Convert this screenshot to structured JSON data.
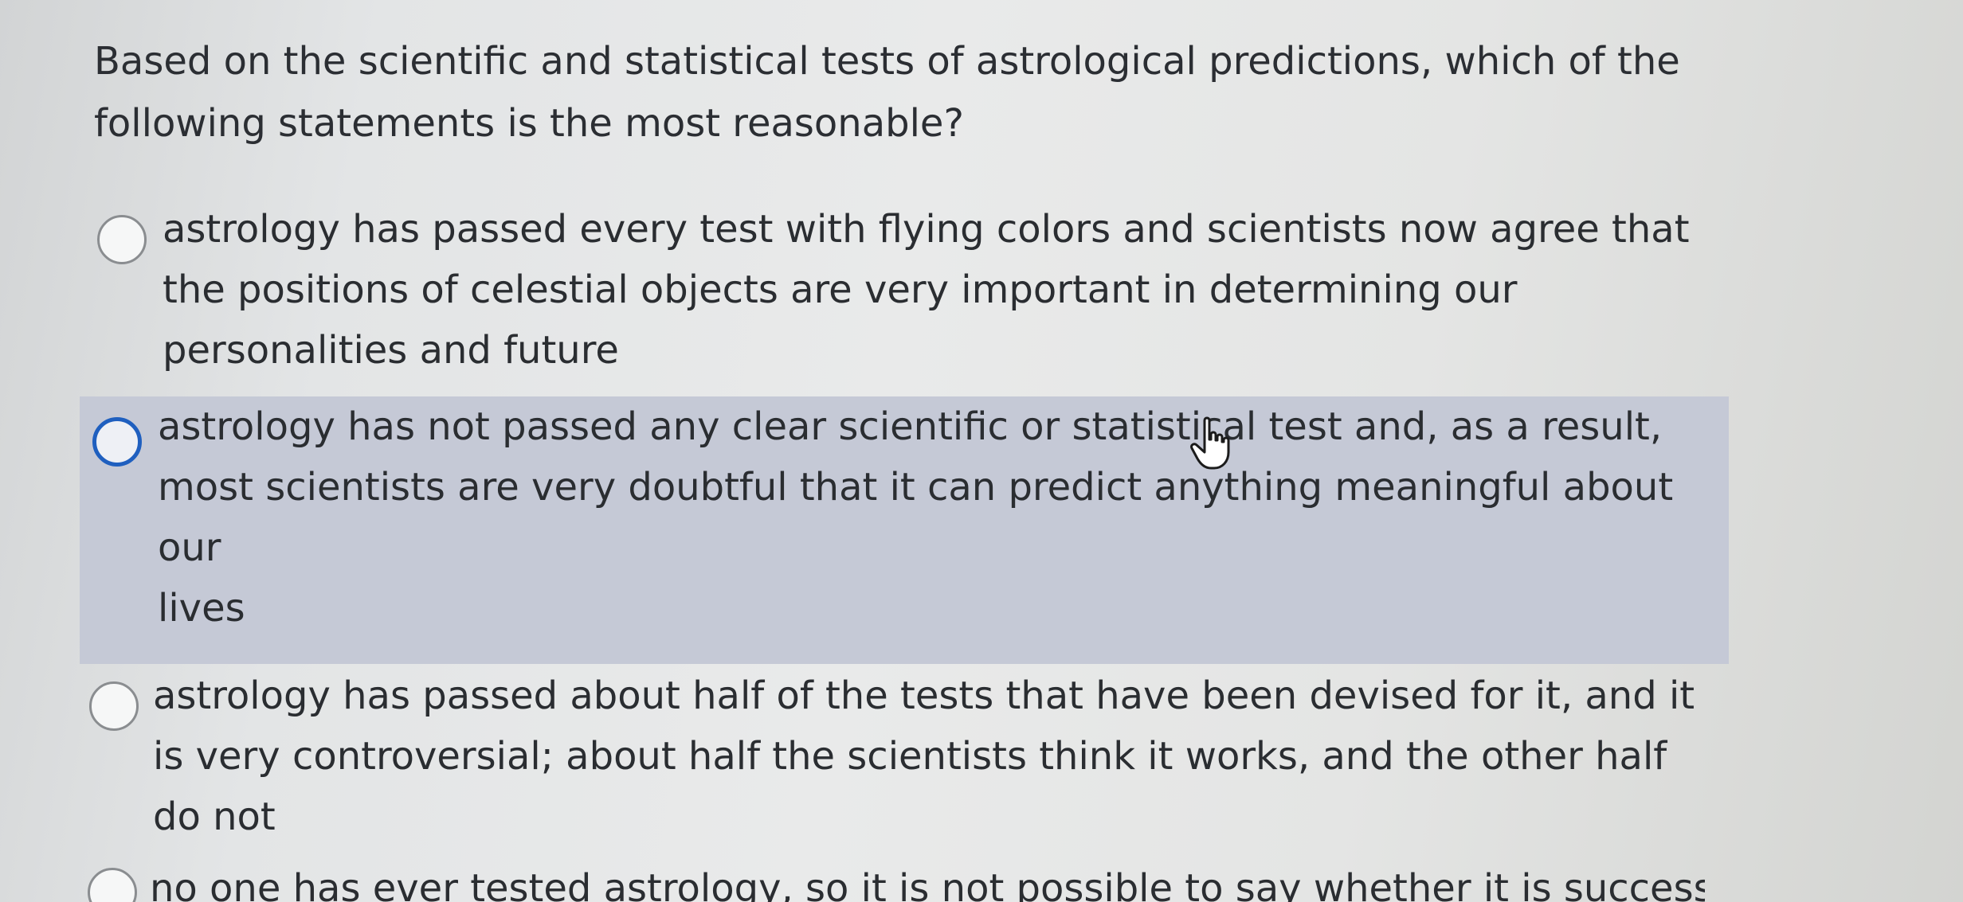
{
  "question": {
    "text": "Based on the scientific and statistical tests of astrological predictions, which of the following statements is the most reasonable?"
  },
  "options": [
    {
      "lines": [
        "astrology has passed every test with flying colors and scientists now agree that",
        "the positions of celestial objects are very important in determining our",
        "personalities and future"
      ],
      "selected": false
    },
    {
      "lines": [
        "astrology has not passed any clear scientific or statistical test and, as a result,",
        "most scientists are very doubtful that it can predict anything meaningful about",
        "our",
        "lives"
      ],
      "selected": false,
      "hovered": true
    },
    {
      "lines": [
        "astrology has passed about half of the tests that have been devised for it, and it",
        "is very controversial; about half the scientists think it works, and the other half",
        "do not"
      ],
      "selected": false
    },
    {
      "lines": [
        "no one has ever tested astrology, so it is not possible to say whether it is successful"
      ],
      "selected": false
    }
  ],
  "colors": {
    "hover_background": "#c5c9d6",
    "hover_radio_border": "#1f5fbf",
    "radio_border": "#8a8d90",
    "text": "#2a2d31"
  },
  "cursor": {
    "icon": "hand-pointer-icon"
  }
}
